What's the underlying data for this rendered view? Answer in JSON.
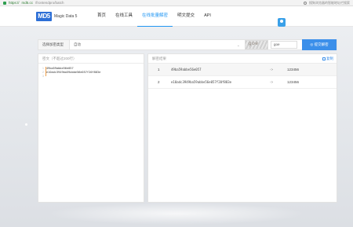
{
  "browser": {
    "protocol": "https://",
    "domain": "md5.cc",
    "path": "/frontendpro/batch",
    "search_hint": "搜狗浏览器的智能地址栏搜索"
  },
  "header": {
    "logo_mark": "MD5",
    "logo_text": "Magic Data 5",
    "nav": [
      "首页",
      "在线工具",
      "在线批量解密",
      "明文提交",
      "API"
    ],
    "active_nav_index": 2
  },
  "toolbar": {
    "label": "选择加密类型",
    "select_value": "自动",
    "captcha_text": "goe",
    "captcha_input": "goe",
    "submit_label": "提交解密"
  },
  "input_panel": {
    "title": "密文（不超过200行）",
    "lines": [
      {
        "num": "1",
        "text": "49ba59abbe56e057"
      },
      {
        "num": "2",
        "text": "e10adc3949ba59abbe56e057f20f883e"
      },
      {
        "num": "3",
        "text": ""
      }
    ]
  },
  "result_panel": {
    "title": "解密结果",
    "copy_label": "复制",
    "rows": [
      {
        "index": "1",
        "hash": "49ba59abbe56e057",
        "arrow": "->",
        "value": "123456"
      },
      {
        "index": "2",
        "hash": "e10adc3949ba59abbe56e057f20f883e",
        "arrow": "->",
        "value": "123456"
      }
    ]
  },
  "colors": {
    "accent": "#2196f3",
    "button": "#3b8fea",
    "logo": "#2d6fd6"
  }
}
